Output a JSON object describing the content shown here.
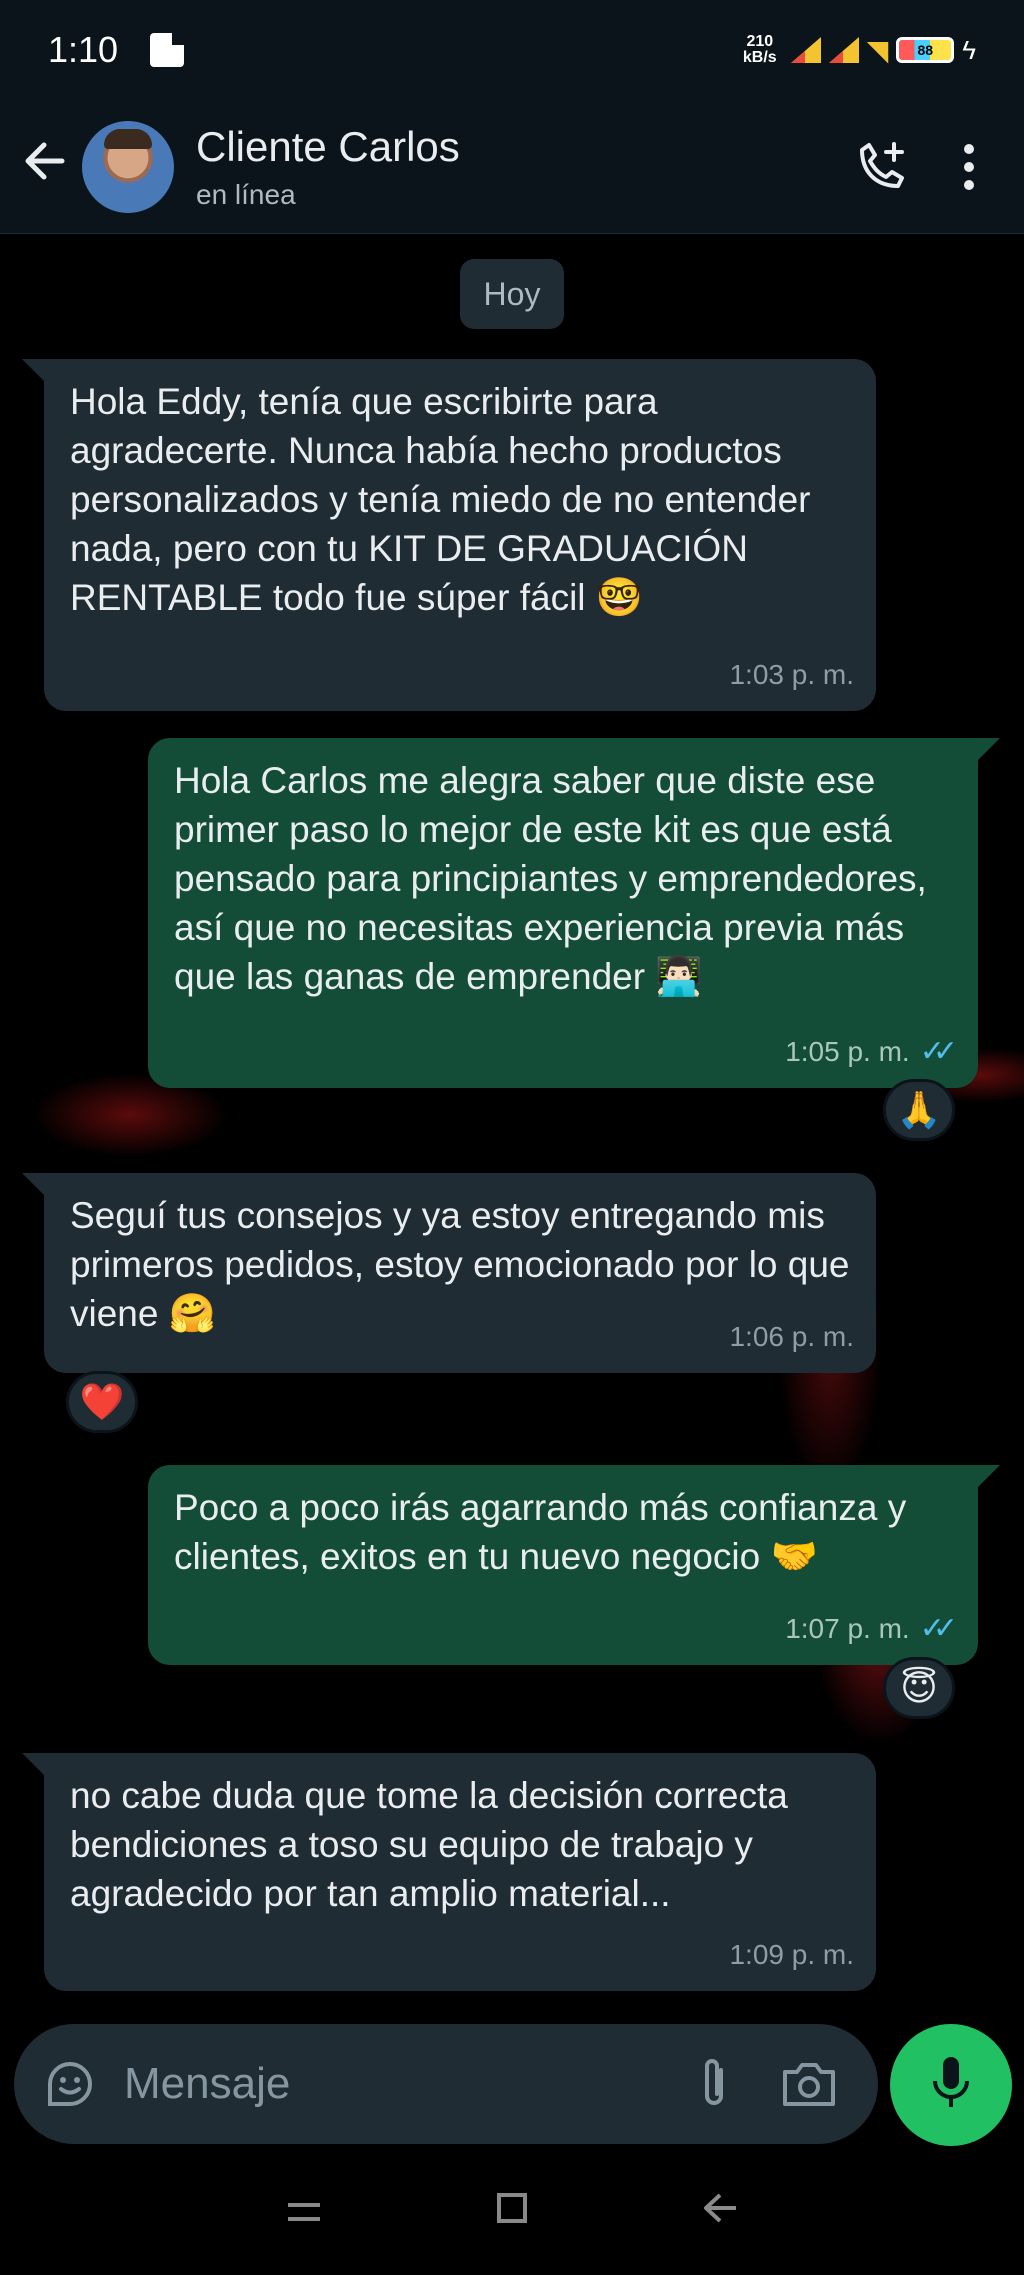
{
  "status_bar": {
    "time": "1:10",
    "speed_value": "210",
    "speed_unit": "kB/s",
    "battery_label": "88"
  },
  "header": {
    "contact_name": "Cliente Carlos",
    "contact_status": "en línea"
  },
  "chat": {
    "date_chip": "Hoy",
    "messages": [
      {
        "direction": "incoming",
        "text": "Hola Eddy, tenía que escribirte para agradecerte. Nunca había hecho productos personalizados y tenía miedo de no entender nada, pero con tu KIT DE GRADUACIÓN RENTABLE todo fue súper fácil",
        "emoji": "🤓",
        "time": "1:03 p. m."
      },
      {
        "direction": "outgoing",
        "text": "Hola Carlos me alegra saber que diste ese primer paso lo mejor de este kit es que está pensado para principiantes y emprendedores, así que no necesitas experiencia previa más que las ganas de emprender",
        "emoji": "👨🏻‍💻",
        "time": "1:05 p. m.",
        "ticks": "✓✓",
        "reaction": "🙏"
      },
      {
        "direction": "incoming",
        "text": "Seguí tus consejos y ya estoy entregando mis primeros pedidos, estoy emocionado por lo que viene",
        "emoji": "🤗",
        "time": "1:06 p. m.",
        "reaction": "❤️"
      },
      {
        "direction": "outgoing",
        "text": "Poco a poco irás agarrando más confianza y clientes, exitos en tu nuevo negocio",
        "emoji": "🤝",
        "time": "1:07 p. m.",
        "ticks": "✓✓",
        "reaction": "😇"
      },
      {
        "direction": "incoming",
        "text": "no cabe duda que tome la decisión correcta bendiciones a toso su equipo de trabajo y agradecido por tan amplio material...",
        "time": "1:09 p. m."
      }
    ]
  },
  "composer": {
    "placeholder": "Mensaje"
  },
  "colors": {
    "incoming_bubble": "#202c33",
    "outgoing_bubble": "#144d37",
    "accent_green": "#21c063",
    "read_ticks": "#53bdeb"
  },
  "icons": {
    "header": [
      "back-arrow-icon",
      "add-call-icon",
      "more-vert-icon"
    ],
    "composer": [
      "sticker-icon",
      "attach-icon",
      "camera-icon",
      "mic-icon"
    ],
    "navbar": [
      "recents-icon",
      "home-icon",
      "back-icon"
    ]
  }
}
